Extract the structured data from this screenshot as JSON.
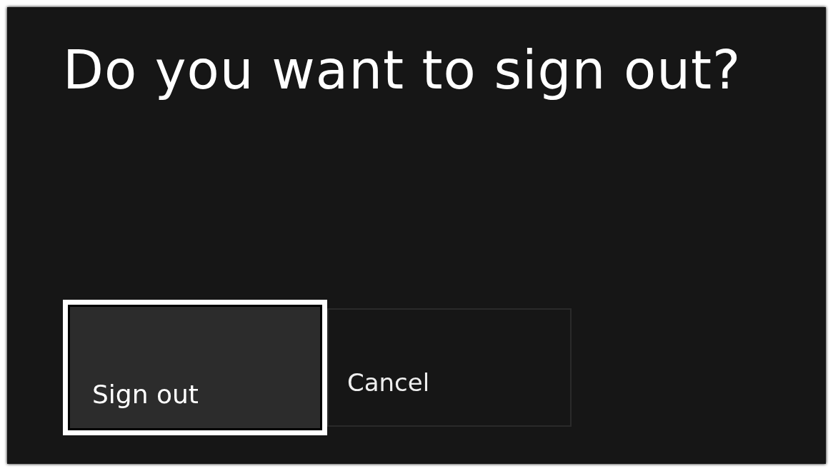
{
  "dialog": {
    "title": "Do you want to sign out?"
  },
  "buttons": [
    {
      "label": "Sign out",
      "selected": true
    },
    {
      "label": "Cancel",
      "selected": false
    }
  ]
}
